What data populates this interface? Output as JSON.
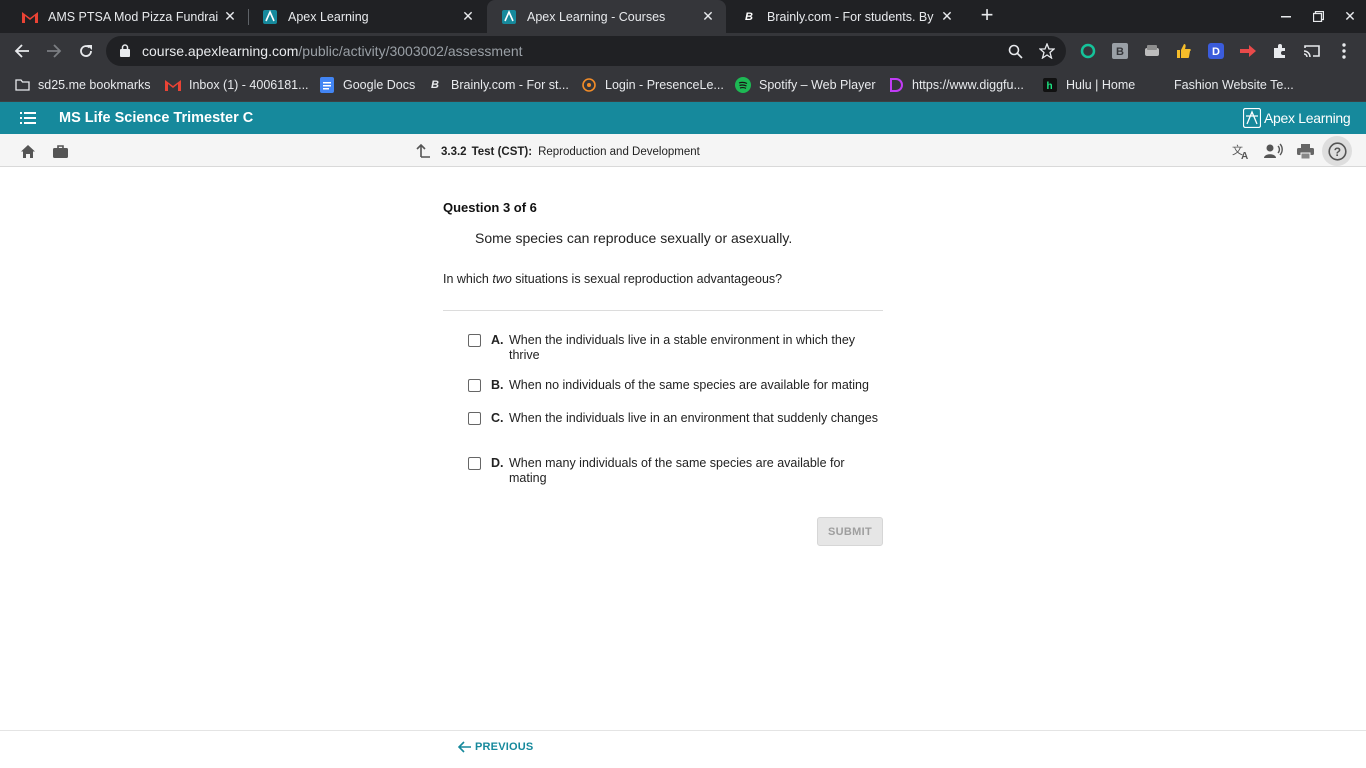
{
  "browser": {
    "tabs": [
      {
        "title": "AMS PTSA Mod Pizza Fundraise",
        "favicon": "gmail-icon"
      },
      {
        "title": "Apex Learning",
        "favicon": "apex-icon"
      },
      {
        "title": "Apex Learning - Courses",
        "favicon": "apex-icon",
        "active": true
      },
      {
        "title": "Brainly.com - For students. By st",
        "favicon": "brainly-icon"
      }
    ],
    "url_host": "course.apexlearning.com",
    "url_path": "/public/activity/3003002/assessment",
    "bookmarks": [
      {
        "label": "sd25.me bookmarks",
        "icon": "folder-icon"
      },
      {
        "label": "Inbox (1) - 4006181...",
        "icon": "gmail-icon"
      },
      {
        "label": "Google Docs",
        "icon": "docs-icon"
      },
      {
        "label": "Brainly.com - For st...",
        "icon": "brainly-icon"
      },
      {
        "label": "Login - PresenceLe...",
        "icon": "presence-icon"
      },
      {
        "label": "Spotify – Web Player",
        "icon": "spotify-icon"
      },
      {
        "label": "https://www.diggfu...",
        "icon": "diggfun-icon"
      },
      {
        "label": "Hulu | Home",
        "icon": "hulu-icon"
      },
      {
        "label": "Fashion Website Te..."
      }
    ]
  },
  "app": {
    "course_title": "MS Life Science Trimester C",
    "brand": "Apex Learning",
    "accent": "#16899c"
  },
  "activity": {
    "number": "3.3.2",
    "kind": "Test (CST):",
    "name": "Reproduction and Development"
  },
  "question": {
    "header": "Question 3 of 6",
    "stem": "Some species can reproduce sexually or asexually.",
    "prompt_before": "In which ",
    "prompt_emphasis": "two",
    "prompt_after": " situations is sexual reproduction advantageous?",
    "choices": [
      {
        "letter": "A.",
        "text": "When the individuals live in a stable environment in which they thrive",
        "checked": false
      },
      {
        "letter": "B.",
        "text": "When no individuals of the same species are available for mating",
        "checked": false
      },
      {
        "letter": "C.",
        "text": "When the individuals live in an environment that suddenly changes",
        "checked": false
      },
      {
        "letter": "D.",
        "text": "When many individuals of the same species are available for mating",
        "checked": false
      }
    ],
    "submit_label": "SUBMIT"
  },
  "footer": {
    "previous_label": "PREVIOUS"
  }
}
